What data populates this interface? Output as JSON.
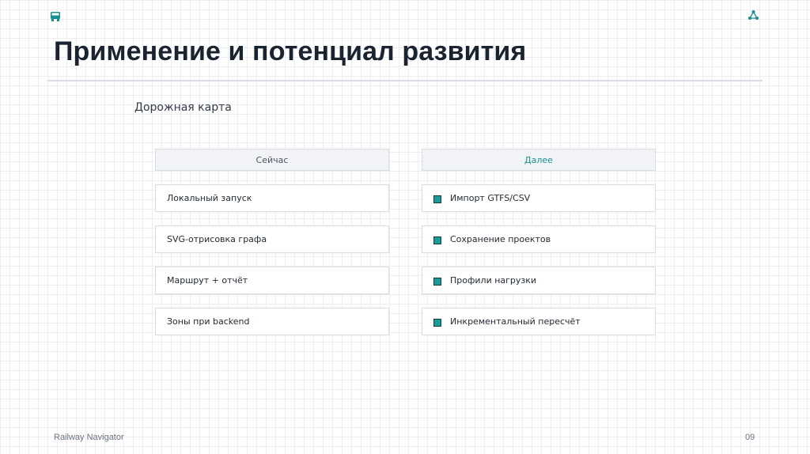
{
  "header": {
    "left_icon": "bus-icon",
    "right_icon": "network-nodes-icon",
    "title": "Применение и потенциал развития"
  },
  "section": {
    "heading": "Дорожная карта"
  },
  "roadmap": {
    "now": {
      "label": "Сейчас",
      "items": [
        "Локальный запуск",
        "SVG-отрисовка графа",
        "Маршрут + отчёт",
        "Зоны при backend"
      ]
    },
    "next": {
      "label": "Далее",
      "items": [
        "Импорт GTFS/CSV",
        "Сохранение проектов",
        "Профили нагрузки",
        "Инкрементальный пересчёт"
      ]
    }
  },
  "footer": {
    "brand": "Railway Navigator",
    "page_number": "09"
  },
  "colors": {
    "accent": "#1a9a99",
    "title": "#1a2330"
  }
}
